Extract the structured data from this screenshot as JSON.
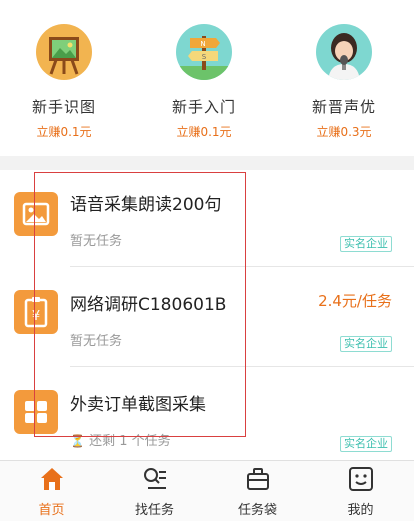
{
  "categories": [
    {
      "title": "新手识图",
      "reward": "立赚0.1元",
      "icon": "easel-icon"
    },
    {
      "title": "新手入门",
      "reward": "立赚0.1元",
      "icon": "signpost-icon"
    },
    {
      "title": "新晋声优",
      "reward": "立赚0.3元",
      "icon": "voice-actor-icon"
    }
  ],
  "tasks": [
    {
      "name": "语音采集朗读200句",
      "sub": "暂无任务",
      "price": "",
      "badge": "实名企业",
      "icon": "image-icon"
    },
    {
      "name": "网络调研C180601B",
      "sub": "暂无任务",
      "price": "2.4元/任务",
      "badge": "实名企业",
      "icon": "survey-icon"
    },
    {
      "name": "外卖订单截图采集",
      "sub": "还剩 1 个任务",
      "price": "",
      "badge": "实名企业",
      "icon": "grid-icon"
    }
  ],
  "tabs": [
    {
      "label": "首页",
      "icon": "home-icon"
    },
    {
      "label": "找任务",
      "icon": "search-list-icon"
    },
    {
      "label": "任务袋",
      "icon": "briefcase-icon"
    },
    {
      "label": "我的",
      "icon": "smiley-icon"
    }
  ],
  "colors": {
    "accent": "#e8701a",
    "badge": "#3cbfae",
    "task_icon": "#f39a3c",
    "highlight_box": "#d94040"
  }
}
